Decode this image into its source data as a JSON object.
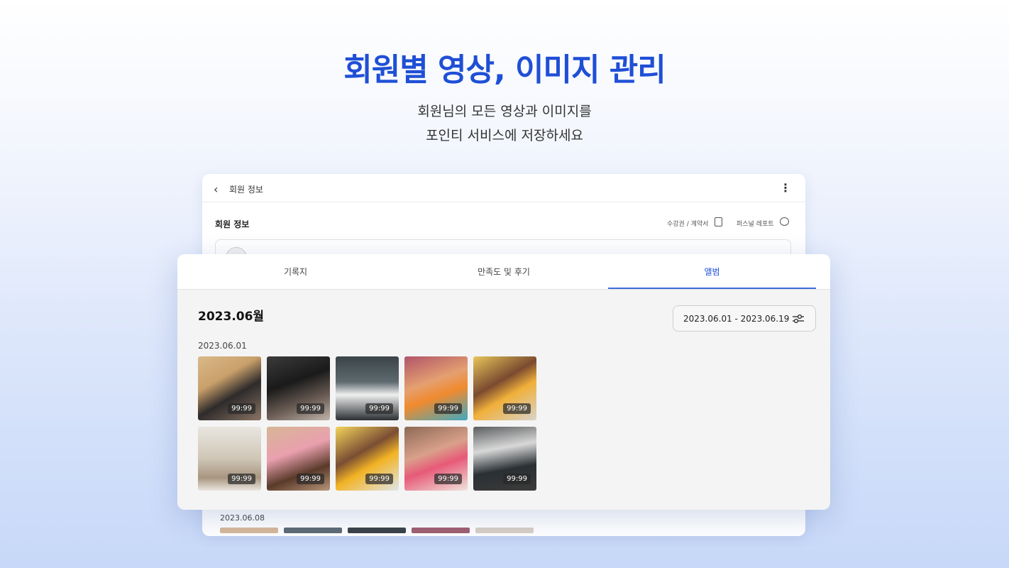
{
  "hero": {
    "title": "회원별 영상, 이미지 관리",
    "subtitle_line1": "회원님의 모든 영상과 이미지를",
    "subtitle_line2": "포인티 서비스에 저장하세요"
  },
  "background_screen": {
    "header_title": "회원 정보",
    "section_title": "회원 정보",
    "link_contract": "수강권 / 계약서",
    "link_report": "퍼스널 레포트",
    "second_date": "2023.06.08"
  },
  "album": {
    "tabs": [
      {
        "label": "기록지",
        "active": false
      },
      {
        "label": "만족도 및 후기",
        "active": false
      },
      {
        "label": "앨범",
        "active": true
      }
    ],
    "month_title": "2023.06월",
    "date_range": "2023.06.01 - 2023.06.19",
    "date_label": "2023.06.01",
    "items": [
      {
        "duration": "99:99",
        "icon": "workout-photo"
      },
      {
        "duration": "99:99",
        "icon": "workout-photo"
      },
      {
        "duration": "99:99",
        "icon": "workout-photo"
      },
      {
        "duration": "99:99",
        "icon": "workout-photo"
      },
      {
        "duration": "99:99",
        "icon": "workout-photo"
      },
      {
        "duration": "99:99",
        "icon": "workout-photo"
      },
      {
        "duration": "99:99",
        "icon": "workout-photo"
      },
      {
        "duration": "99:99",
        "icon": "workout-photo"
      },
      {
        "duration": "99:99",
        "icon": "workout-photo"
      },
      {
        "duration": "99:99",
        "icon": "workout-photo"
      }
    ]
  },
  "colors": {
    "accent": "#1f4fd6",
    "tab_indicator": "#3d6fd8"
  }
}
